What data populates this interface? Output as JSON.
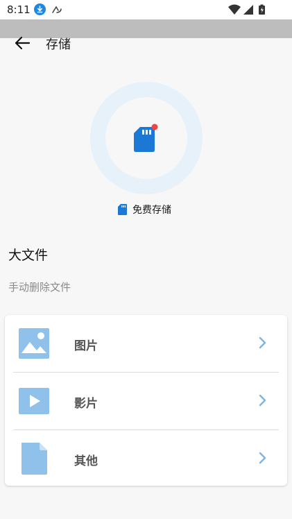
{
  "status_bar": {
    "time": "8:11"
  },
  "app_bar": {
    "title": "存储"
  },
  "storage": {
    "label": "免费存储",
    "ring_color": "#e6f1fa",
    "card_color": "#1b78d4",
    "dot_color": "#ef4444"
  },
  "section": {
    "title": "大文件",
    "subtitle": "手动删除文件"
  },
  "items": [
    {
      "label": "图片",
      "icon": "image-icon"
    },
    {
      "label": "影片",
      "icon": "video-icon"
    },
    {
      "label": "其他",
      "icon": "file-icon"
    }
  ],
  "colors": {
    "accent_icon": "#8fc1eb",
    "chevron": "#7fb3e0"
  }
}
